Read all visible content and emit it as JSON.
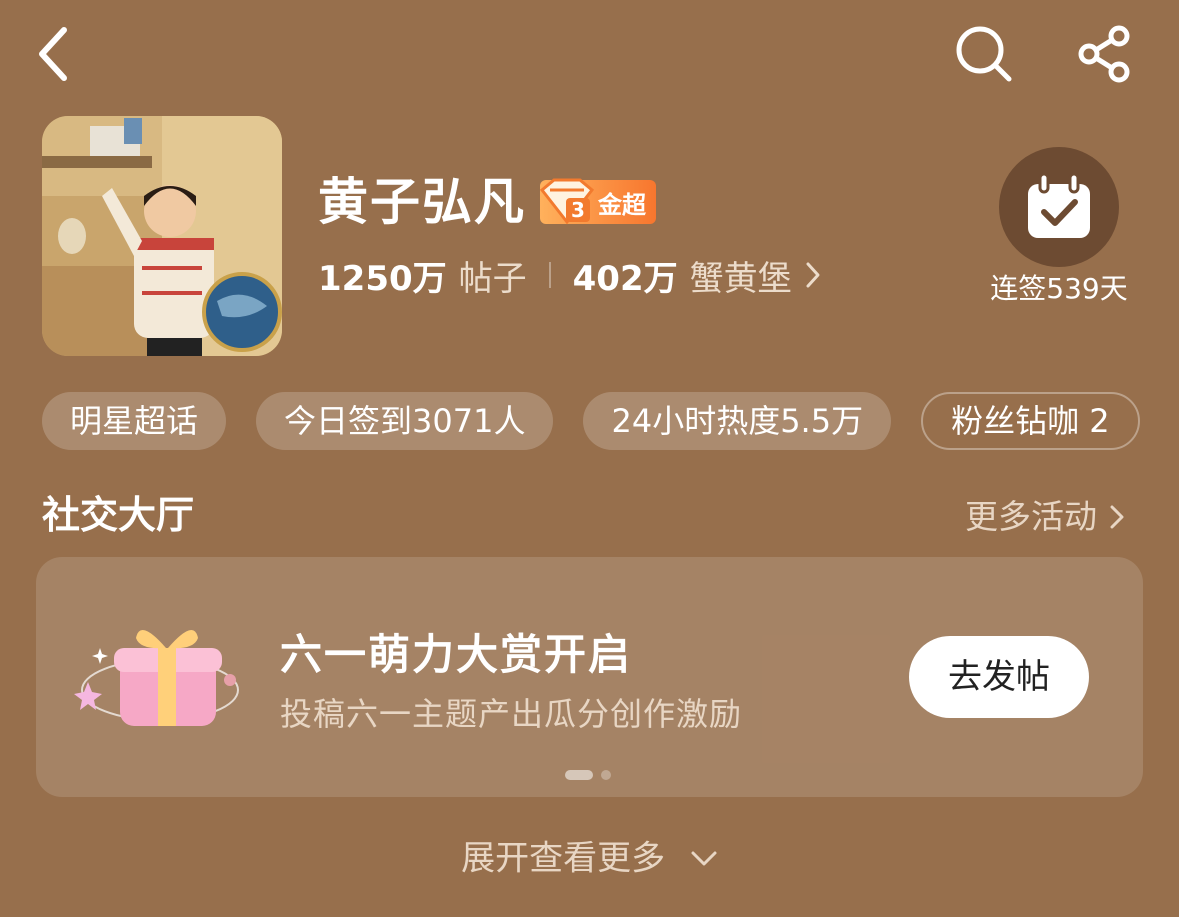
{
  "header": {
    "back_icon": "chevron-left-icon",
    "search_icon": "search-icon",
    "share_icon": "share-icon"
  },
  "profile": {
    "name": "黄子弘凡",
    "badge_level": "3",
    "badge_label": "金超",
    "posts_count": "1250万",
    "posts_label": "帖子",
    "fans_count": "402万",
    "fans_label": "蟹黄堡"
  },
  "checkin": {
    "label": "连签539天"
  },
  "chips": [
    "明星超话",
    "今日签到3071人",
    "24小时热度5.5万",
    "粉丝钻咖 2"
  ],
  "section": {
    "title": "社交大厅",
    "more": "更多活动"
  },
  "card": {
    "title": "六一萌力大赏开启",
    "subtitle": "投稿六一主题产出瓜分创作激励",
    "button": "去发帖"
  },
  "expand": {
    "label": "展开查看更多"
  },
  "colors": {
    "background": "#976f4c",
    "badge_gradient_start": "#ffb15c",
    "badge_gradient_end": "#f7762e",
    "checkin_circle": "#6d4b32"
  }
}
